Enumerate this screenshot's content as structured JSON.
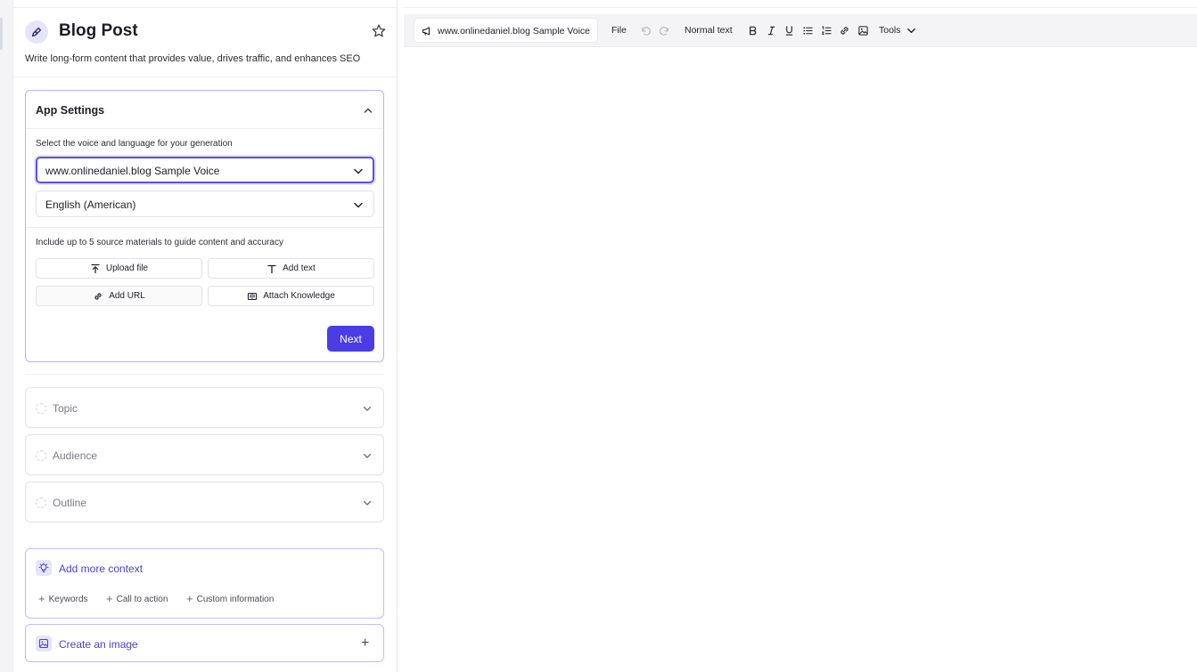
{
  "app": {
    "title": "Blog Post",
    "description": "Write long-form content that provides value, drives traffic, and enhances SEO"
  },
  "settings": {
    "title": "App Settings",
    "voice_label": "Select the voice and language for your generation",
    "voice_value": "www.onlinedaniel.blog Sample Voice",
    "language_value": "English (American)",
    "sources_label": "Include up to 5 source materials to guide content and accuracy",
    "upload_file": "Upload file",
    "add_text": "Add text",
    "add_url": "Add URL",
    "attach_knowledge": "Attach Knowledge",
    "next": "Next"
  },
  "steps": [
    {
      "label": "Topic"
    },
    {
      "label": "Audience"
    },
    {
      "label": "Outline"
    }
  ],
  "context": {
    "title": "Add more context",
    "chips": [
      "Keywords",
      "Call to action",
      "Custom information"
    ]
  },
  "image": {
    "title": "Create an image"
  },
  "toolbar": {
    "voice": "www.onlinedaniel.blog Sample Voice",
    "file": "File",
    "text_style": "Normal text",
    "tools": "Tools"
  },
  "colors": {
    "accent": "#4b3de6",
    "accent_text": "#4d43c9",
    "accent_soft": "#e6e4fa"
  },
  "icons": [
    "pen-icon",
    "star-icon",
    "chevron-up-icon",
    "chevron-down-icon",
    "upload-icon",
    "text-icon",
    "link-icon",
    "book-icon",
    "lightbulb-icon",
    "image-icon",
    "megaphone-icon",
    "undo-icon",
    "redo-icon",
    "bold-icon",
    "italic-icon",
    "underline-icon",
    "bullet-list-icon",
    "numbered-list-icon",
    "insert-image-icon"
  ]
}
